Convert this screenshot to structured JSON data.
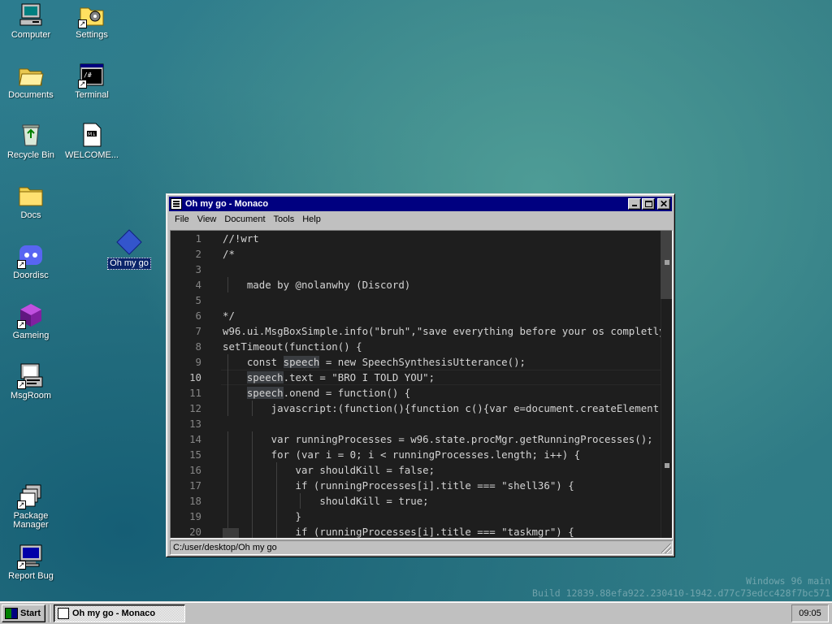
{
  "desktop": {
    "icons": [
      {
        "label": "Computer"
      },
      {
        "label": "Settings"
      },
      {
        "label": "Documents"
      },
      {
        "label": "Terminal"
      },
      {
        "label": "Recycle Bin"
      },
      {
        "label": "WELCOME..."
      },
      {
        "label": "Docs"
      },
      {
        "label": "Doordisc"
      },
      {
        "label": "Oh my go"
      },
      {
        "label": "Gameing"
      },
      {
        "label": "MsgRoom"
      },
      {
        "label": "Package Manager"
      },
      {
        "label": "Report Bug"
      }
    ],
    "watermark": {
      "line1": "Windows 96 main",
      "line2": "Build 12839.88efa922.230410-1942.d77c73edcc428f7bc571"
    }
  },
  "window": {
    "title": "Oh my go - Monaco",
    "menu": [
      "File",
      "View",
      "Document",
      "Tools",
      "Help"
    ],
    "status_path": "C:/user/desktop/Oh my go",
    "active_line": 10,
    "lines": [
      "//!wrt",
      "/*",
      "",
      "    made by @nolanwhy (Discord)",
      "",
      "*/",
      "w96.ui.MsgBoxSimple.info(\"bruh\",\"save everything before your os completly",
      "setTimeout(function() {",
      "    const speech = new SpeechSynthesisUtterance();",
      "    speech.text = \"BRO I TOLD YOU\";",
      "    speech.onend = function() {",
      "        javascript:(function(){function c(){var e=document.createElement",
      "",
      "        var runningProcesses = w96.state.procMgr.getRunningProcesses();",
      "        for (var i = 0; i < runningProcesses.length; i++) {",
      "            var shouldKill = false;",
      "            if (runningProcesses[i].title === \"shell36\") {",
      "                shouldKill = true;",
      "            }",
      "            if (runningProcesses[i].title === \"taskmgr\") {"
    ]
  },
  "taskbar": {
    "start_label": "Start",
    "task_label": "Oh my go - Monaco",
    "clock": "09:05"
  }
}
